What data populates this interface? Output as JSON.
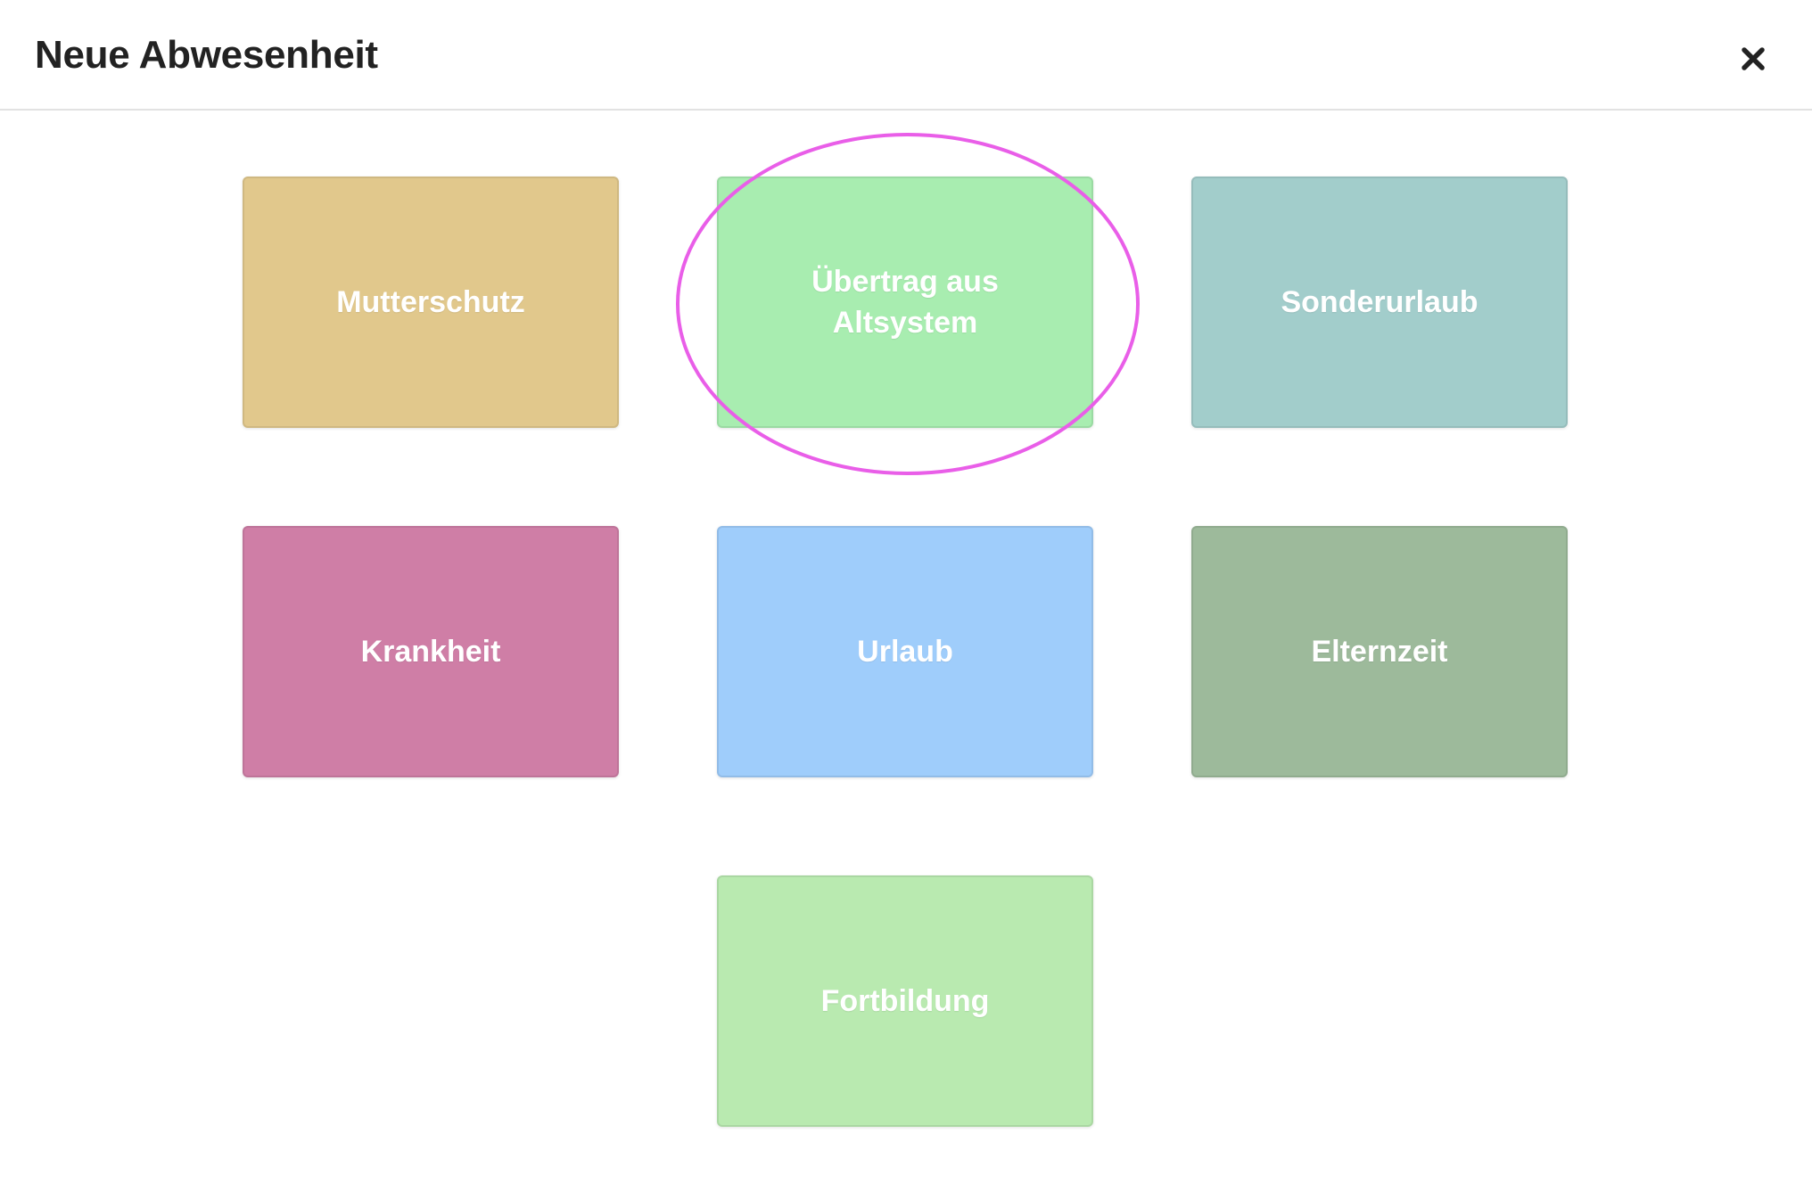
{
  "dialog": {
    "title": "Neue Abwesenheit",
    "close_icon": "close-icon"
  },
  "absence_types": [
    {
      "label": "Mutterschutz",
      "color": "#e1c88c"
    },
    {
      "label": "Übertrag aus Altsystem",
      "color": "#a8edb0"
    },
    {
      "label": "Sonderurlaub",
      "color": "#a2cdcb"
    },
    {
      "label": "Krankheit",
      "color": "#cf7ea6"
    },
    {
      "label": "Urlaub",
      "color": "#9fcdfb"
    },
    {
      "label": "Elternzeit",
      "color": "#9dba9b"
    },
    {
      "label": "Fortbildung",
      "color": "#b9eab0"
    }
  ],
  "annotation": {
    "highlight_color": "#e95ee8"
  }
}
